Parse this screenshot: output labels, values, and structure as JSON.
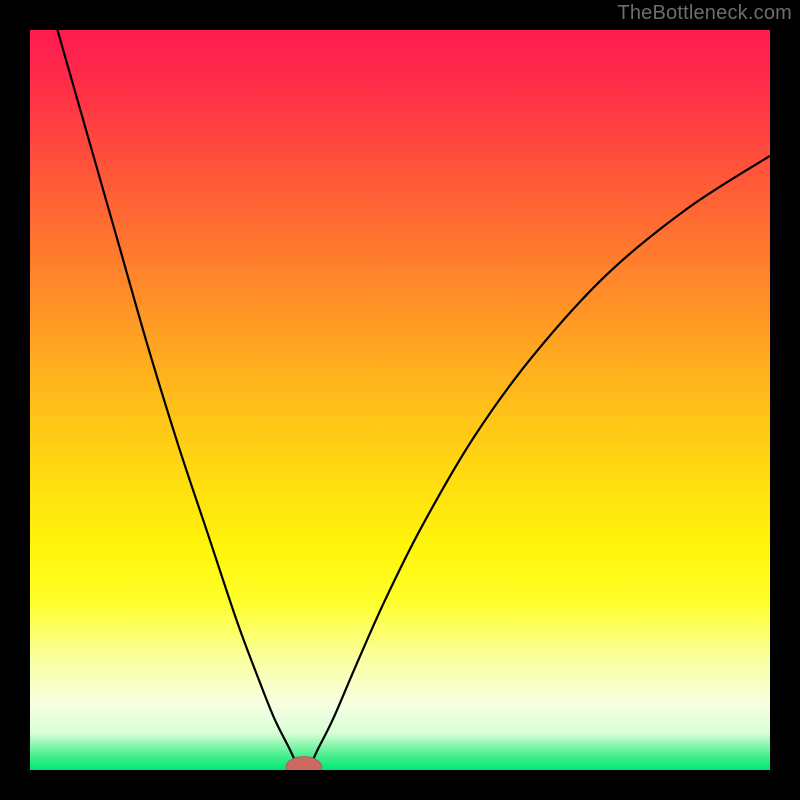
{
  "watermark": "TheBottleneck.com",
  "colors": {
    "frame": "#000000",
    "curve": "#000000",
    "marker_fill": "#c96a63",
    "marker_stroke": "#b85a54",
    "gradient_top": "#ff1a4f",
    "gradient_bottom": "#00e676"
  },
  "chart_data": {
    "type": "line",
    "title": "",
    "xlabel": "",
    "ylabel": "",
    "xlim": [
      0,
      100
    ],
    "ylim": [
      0,
      100
    ],
    "grid": false,
    "legend": null,
    "optimum_x": 37,
    "series": [
      {
        "name": "bottleneck-curve",
        "x": [
          0,
          4,
          8,
          12,
          16,
          20,
          24,
          28,
          31,
          33,
          35,
          36,
          37,
          38,
          39,
          41,
          44,
          48,
          53,
          60,
          68,
          78,
          89,
          100
        ],
        "y": [
          113,
          99,
          85,
          71,
          57,
          44,
          32,
          20,
          12,
          7,
          3,
          1,
          0,
          1,
          3,
          7,
          14,
          23,
          33,
          45,
          56,
          67,
          76,
          83
        ]
      }
    ],
    "marker": {
      "x": 37,
      "y": 0,
      "rx": 2.4,
      "ry": 1.0
    }
  }
}
